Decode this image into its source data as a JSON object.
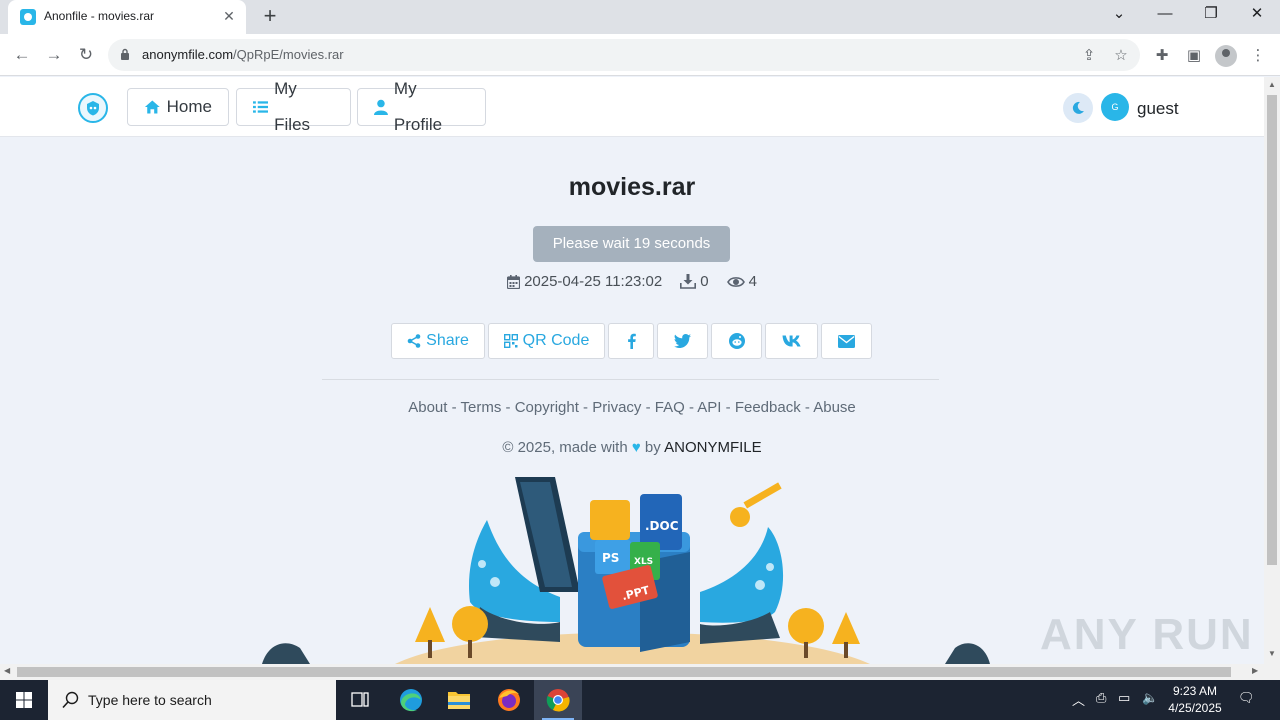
{
  "browser": {
    "tab_title": "Anonfile - movies.rar",
    "url_host": "anonymfile.com",
    "url_path": "/QpRpE/movies.rar"
  },
  "nav": {
    "home": "Home",
    "my_files": "My Files",
    "my_profile": "My Profile",
    "avatar_initial": "G",
    "username": "guest"
  },
  "file": {
    "name": "movies.rar",
    "wait_text": "Please wait 19 seconds",
    "date": "2025-04-25 11:23:02",
    "downloads": "0",
    "views": "4"
  },
  "share": {
    "share_label": "Share",
    "qr_label": "QR Code"
  },
  "footer": {
    "links": [
      "About",
      "Terms",
      "Copyright",
      "Privacy",
      "FAQ",
      "API",
      "Feedback",
      "Abuse"
    ],
    "separator": " - ",
    "copyright_prefix": "© 2025, made with",
    "by": "by",
    "brand": "ANONYMFILE"
  },
  "taskbar": {
    "search_placeholder": "Type here to search",
    "time": "9:23 AM",
    "date": "4/25/2025"
  },
  "watermark": "ANY RUN",
  "colors": {
    "accent": "#29b6e8",
    "wait_button": "#a5b1bd",
    "page_bg": "#eef2f9",
    "taskbar": "#1c2432"
  }
}
